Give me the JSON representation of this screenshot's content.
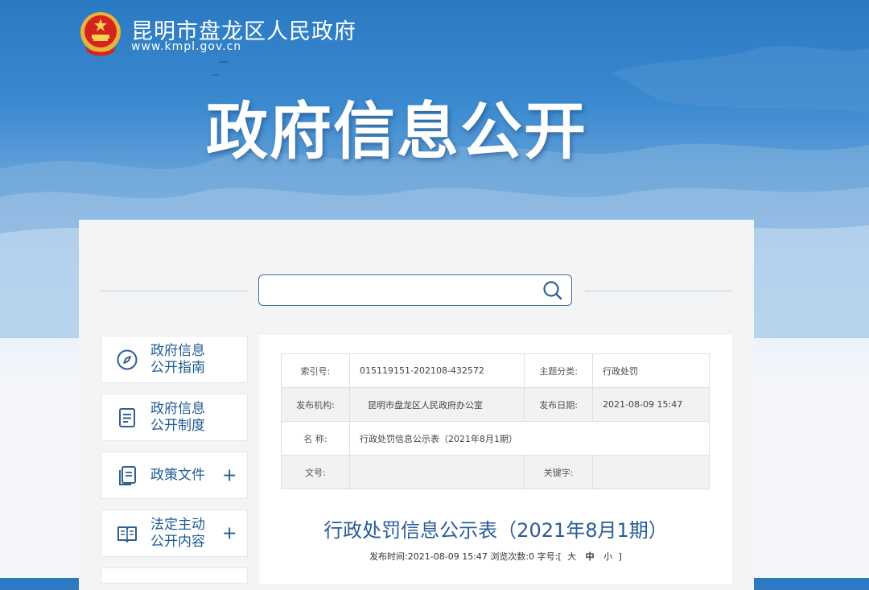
{
  "header": {
    "site_name": "昆明市盘龙区人民政府",
    "site_url": "www.kmpl.gov.cn",
    "hero_title": "政府信息公开"
  },
  "search": {
    "placeholder": "",
    "icon": "search-icon"
  },
  "sidebar": {
    "items": [
      {
        "label_line1": "政府信息",
        "label_line2": "公开指南",
        "icon": "compass-icon",
        "expandable": false
      },
      {
        "label_line1": "政府信息",
        "label_line2": "公开制度",
        "icon": "document-icon",
        "expandable": false
      },
      {
        "label": "政策文件",
        "icon": "files-icon",
        "expandable": true,
        "plus": "+"
      },
      {
        "label_line1": "法定主动",
        "label_line2": "公开内容",
        "icon": "book-icon",
        "expandable": true,
        "plus": "+"
      }
    ]
  },
  "meta_table": {
    "index_no_label": "索引号:",
    "index_no": "015119151-202108-432572",
    "topic_label": "主题分类:",
    "topic": "行政处罚",
    "publisher_label": "发布机构:",
    "publisher": "昆明市盘龙区人民政府办公室",
    "date_label": "发布日期:",
    "date": "2021-08-09 15:47",
    "name_label": "名 称:",
    "name": "行政处罚信息公示表（2021年8月1期）",
    "doc_no_label": "文号:",
    "doc_no": "",
    "keywords_label": "关键字:",
    "keywords": ""
  },
  "article": {
    "title": "行政处罚信息公示表（2021年8月1期）",
    "publish_time_label": "发布时间:",
    "publish_time": "2021-08-09 15:47",
    "views_label": "浏览次数:",
    "views": "0",
    "font_size_label": "字号:",
    "bracket_open": "[",
    "size_large": "大",
    "size_medium": "中",
    "size_small": "小",
    "bracket_close": "]"
  },
  "colors": {
    "accent": "#1f5a96",
    "title_blue": "#2a5c98",
    "sky_top": "#2a79c2"
  }
}
